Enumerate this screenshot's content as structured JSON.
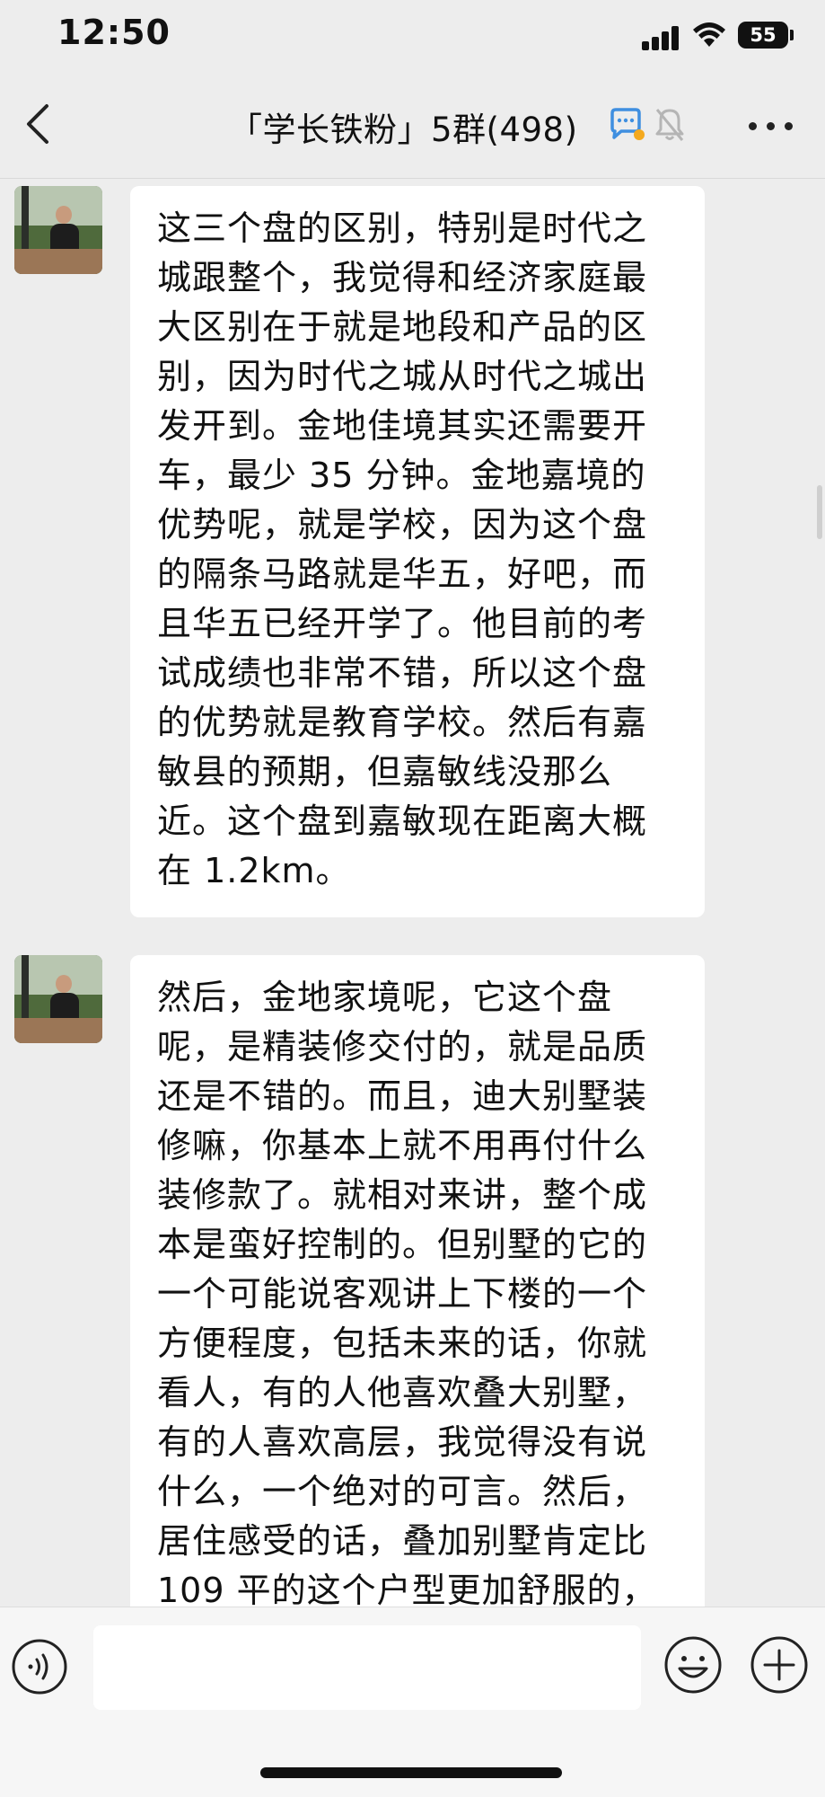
{
  "status_bar": {
    "time": "12:50",
    "battery": "55"
  },
  "header": {
    "title": "「学长铁粉」5群(498)",
    "icons": {
      "back": "chevron-left-icon",
      "chat": "chat-bubble-icon",
      "mute": "bell-muted-icon",
      "more": "more-icon"
    }
  },
  "messages": [
    {
      "text": "这三个盘的区别，特别是时代之城跟整个，我觉得和经济家庭最大区别在于就是地段和产品的区别，因为时代之城从时代之城出发开到。金地佳境其实还需要开车，最少 35 分钟。金地嘉境的优势呢，就是学校，因为这个盘的隔条马路就是华五，好吧，而且华五已经开学了。他目前的考试成绩也非常不错，所以这个盘的优势就是教育学校。然后有嘉敏县的预期，但嘉敏线没那么近。这个盘到嘉敏现在距离大概在 1.2km。"
    },
    {
      "text": "然后，金地家境呢，它这个盘呢，是精装修交付的，就是品质还是不错的。而且，迪大别墅装修嘛，你基本上就不用再付什么装修款了。就相对来讲，整个成本是蛮好控制的。但别墅的它的一个可能说客观讲上下楼的一个方便程度，包括未来的话，你就看人，有的人他喜欢叠大别墅，有的人喜欢高层，我觉得没有说什么，一个绝对的可言。然后，居住感受的话，叠加别墅肯定比 109 平的这个户型更加舒服的，"
    }
  ],
  "input_bar": {
    "placeholder": "",
    "icons": {
      "voice": "voice-icon",
      "emoji": "emoji-icon",
      "plus": "plus-icon"
    }
  }
}
